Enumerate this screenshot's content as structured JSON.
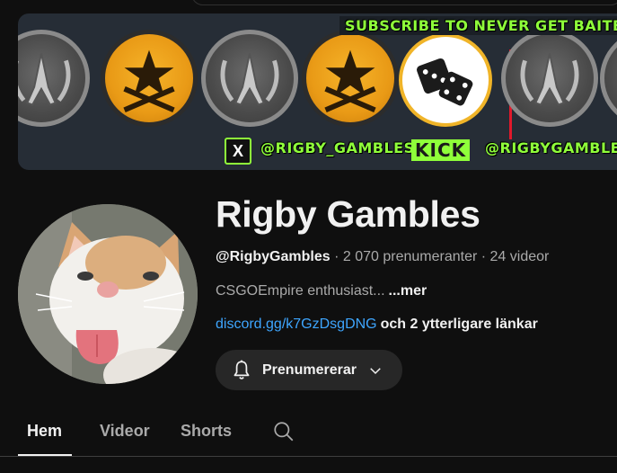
{
  "banner": {
    "tagline": "SUBSCRIBE TO NEVER GET BAITED BY",
    "x_logo": "X",
    "twitter_handle": "@RIGBY_GAMBLES",
    "kick_logo": "KICK",
    "kick_handle": "@RIGBYGAMBLE"
  },
  "channel": {
    "name": "Rigby Gambles",
    "handle": "@RigbyGambles",
    "separator": " · ",
    "subscribers": "2 070 prenumeranter",
    "videos": "24 videor",
    "description": "CSGOEmpire enthusiast...",
    "more_label": "...mer",
    "link": "discord.gg/k7GzDsgDNG",
    "extra_links": "och 2 ytterligare länkar"
  },
  "subscribe_button": {
    "label": "Prenumererar",
    "icon": "bell-icon"
  },
  "tabs": [
    {
      "label": "Hem",
      "active": true
    },
    {
      "label": "Videor",
      "active": false
    },
    {
      "label": "Shorts",
      "active": false
    }
  ],
  "colors": {
    "background": "#0f0f0f",
    "link": "#3ea6ff",
    "banner_text": "#8fff3a",
    "gold_coin": "#e99a16"
  }
}
